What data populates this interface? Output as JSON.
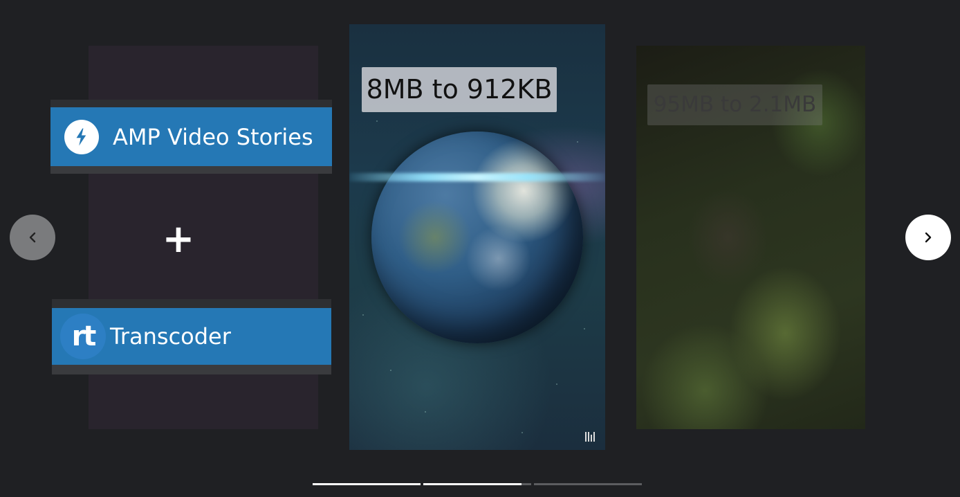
{
  "left_card": {
    "amp_title": "AMP Video Stories",
    "amp_icon": "lightning-bolt-icon",
    "plus": "+",
    "transcoder_title": "Transcoder",
    "transcoder_logo_text": "rt"
  },
  "center_card": {
    "size_label": "8MB to 912KB",
    "image": "earth-globe",
    "corner_icon": "bars-icon"
  },
  "right_card": {
    "size_label": "95MB to 2.1MB",
    "image": "forest-aerial"
  },
  "nav": {
    "prev_icon": "chevron-left-icon",
    "prev_label": "‹",
    "next_icon": "chevron-right-icon",
    "next_label": "›"
  },
  "progress": [
    {
      "value": 1.0
    },
    {
      "value": 0.91
    },
    {
      "value": 0.0
    }
  ],
  "colors": {
    "background": "#1f2023",
    "banner_blue": "#2578b5"
  }
}
